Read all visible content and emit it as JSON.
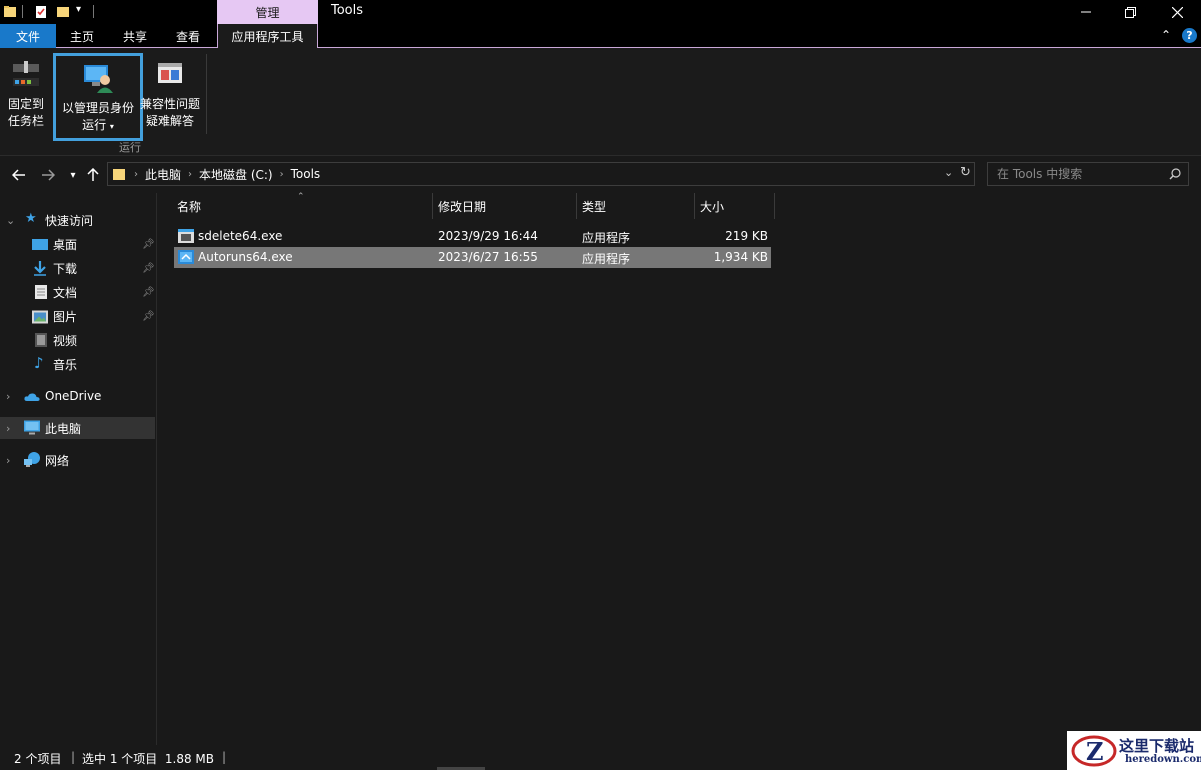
{
  "titlebar": {
    "context_tab": "管理",
    "window_title": "Tools"
  },
  "ribbon_tabs": {
    "file": "文件",
    "home": "主页",
    "share": "共享",
    "view": "查看",
    "app_tools": "应用程序工具"
  },
  "ribbon": {
    "pin_taskbar_line1": "固定到",
    "pin_taskbar_line2": "任务栏",
    "run_as_admin_line1": "以管理员身份",
    "run_as_admin_line2": "运行",
    "compat_line1": "兼容性问题",
    "compat_line2": "疑难解答",
    "group_label": "运行"
  },
  "address": {
    "crumbs": [
      "此电脑",
      "本地磁盘 (C:)",
      "Tools"
    ],
    "search_placeholder": "在 Tools 中搜索"
  },
  "sidebar": {
    "quick_access": "快速访问",
    "items": [
      {
        "label": "桌面",
        "icon": "desktop-icon",
        "pinned": true
      },
      {
        "label": "下载",
        "icon": "download-icon",
        "pinned": true
      },
      {
        "label": "文档",
        "icon": "document-icon",
        "pinned": true
      },
      {
        "label": "图片",
        "icon": "picture-icon",
        "pinned": true
      },
      {
        "label": "视频",
        "icon": "video-icon",
        "pinned": false
      },
      {
        "label": "音乐",
        "icon": "music-icon",
        "pinned": false
      }
    ],
    "onedrive": "OneDrive",
    "this_pc": "此电脑",
    "network": "网络"
  },
  "columns": {
    "name": "名称",
    "modified": "修改日期",
    "type": "类型",
    "size": "大小"
  },
  "files": [
    {
      "name": "sdelete64.exe",
      "modified": "2023/9/29 16:44",
      "type": "应用程序",
      "size": "219 KB",
      "selected": false
    },
    {
      "name": "Autoruns64.exe",
      "modified": "2023/6/27 16:55",
      "type": "应用程序",
      "size": "1,934 KB",
      "selected": true
    }
  ],
  "status": {
    "item_count": "2 个项目",
    "selection": "选中 1 个项目  1.88 MB"
  },
  "watermark": {
    "text": "这里下载站",
    "url": "heredown.com"
  },
  "colors": {
    "accent_blue": "#1979ca",
    "context_tab": "#e6c8f3",
    "selection_bg": "#777777",
    "highlight_border": "#43a0dd"
  }
}
